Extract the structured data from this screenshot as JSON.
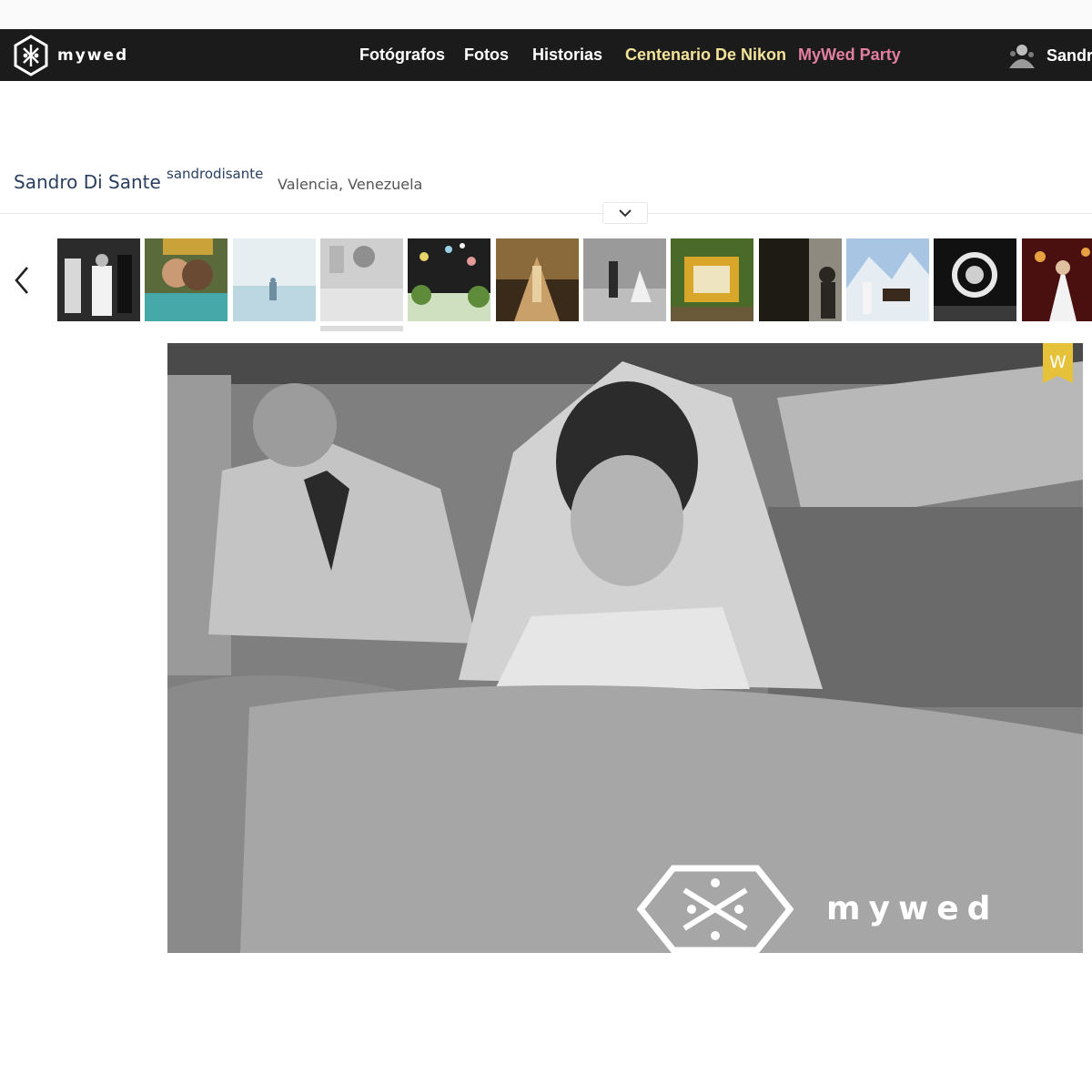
{
  "brand": {
    "logo_text": "mywed",
    "watermark_text": "mywed",
    "award_badge_letter": "W"
  },
  "nav": {
    "items": [
      {
        "label": "Fotógrafos"
      },
      {
        "label": "Fotos"
      },
      {
        "label": "Historias"
      },
      {
        "label": "Centenario De Nikon",
        "color": "#f3e49a"
      },
      {
        "label": "MyWed Party",
        "color": "#e47fa0"
      }
    ],
    "user_name": "Sandro"
  },
  "profile": {
    "name": "Sandro Di Sante",
    "username": "sandrodisante",
    "location": "Valencia, Venezuela"
  },
  "gallery": {
    "thumbnail_count": 12,
    "active_thumbnail_index": 3
  },
  "colors": {
    "navbar_bg": "#1b1b1b",
    "profile_name": "#2a3f5f",
    "award_badge": "#e6c23a"
  },
  "icons": {
    "logo": "mywed-logo-icon",
    "user": "user-avatar",
    "expand": "chevron-down-icon",
    "prev": "chevron-left-icon",
    "award": "award-badge-icon"
  }
}
